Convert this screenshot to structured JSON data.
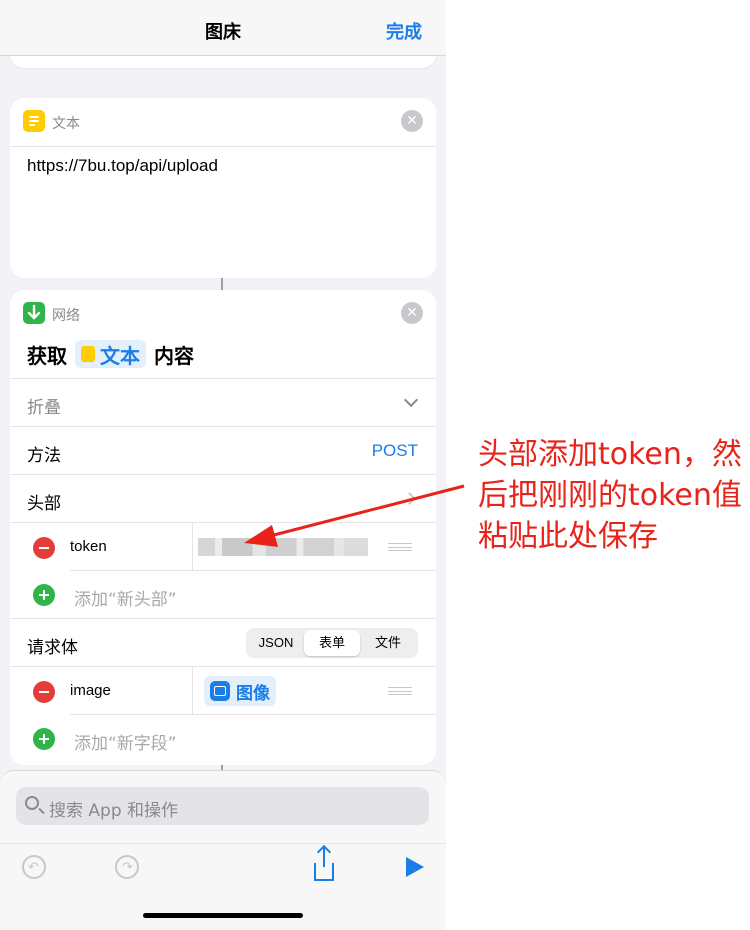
{
  "header": {
    "title": "图床",
    "done_label": "完成"
  },
  "text_action": {
    "icon": "text-doc-icon",
    "label": "文本",
    "content": "https://7bu.top/api/upload"
  },
  "network_action": {
    "icon": "download-arrow-icon",
    "label": "网络",
    "summary_prefix": "获取",
    "summary_token": "文本",
    "summary_suffix": "内容",
    "collapse_label": "折叠",
    "method_label": "方法",
    "method_value": "POST",
    "headers_label": "头部",
    "header_rows": [
      {
        "key": "token"
      }
    ],
    "add_header_label": "添加“新头部”",
    "body_label": "请求体",
    "body_types": [
      "JSON",
      "表单",
      "文件"
    ],
    "body_type_selected": "表单",
    "body_rows": [
      {
        "key": "image",
        "value": "图像"
      }
    ],
    "add_field_label": "添加“新字段”"
  },
  "bottom_sheet": {
    "search_placeholder": "搜索 App 和操作"
  },
  "annotation": {
    "text": "头部添加token，然后把刚刚的token值粘贴此处保存",
    "color": "#e8231a"
  },
  "colors": {
    "accent": "#1a7ee6",
    "delete": "#e43b3b",
    "add": "#2fb44a",
    "text_icon": "#ffcc00"
  }
}
